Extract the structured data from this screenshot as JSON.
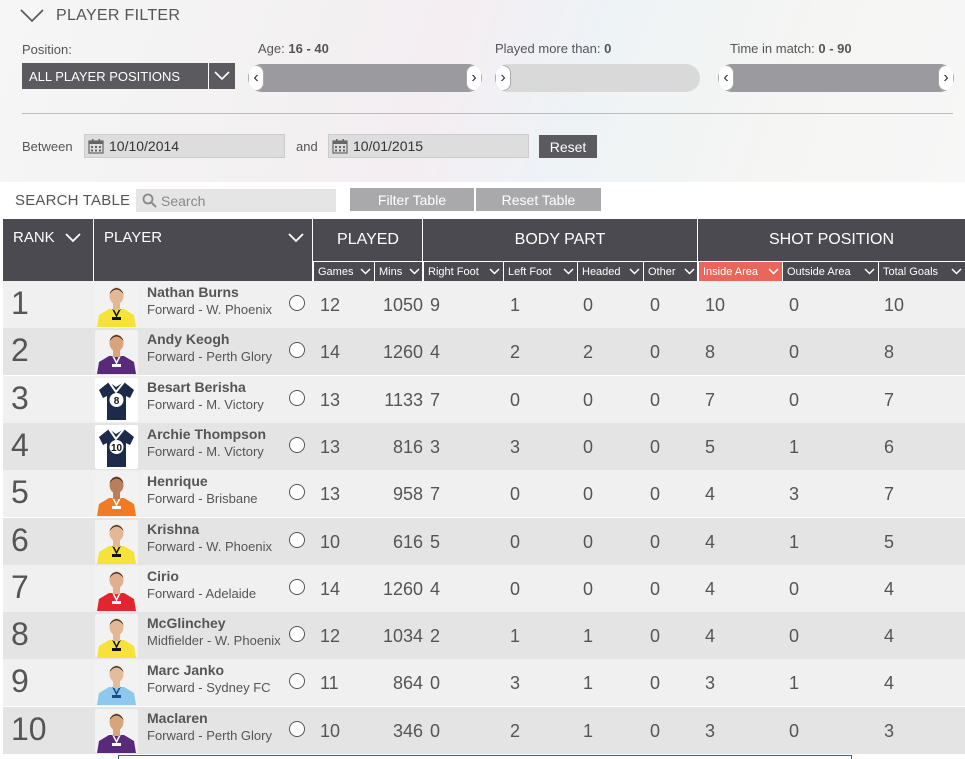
{
  "filter": {
    "title": "PLAYER FILTER",
    "position_label": "Position:",
    "position_value": "ALL PLAYER POSITIONS",
    "age_label": "Age:",
    "age_value": "16 - 40",
    "played_label": "Played more than:",
    "played_value": "0",
    "time_label": "Time in match:",
    "time_value": "0 - 90",
    "between_label": "Between",
    "and_label": "and",
    "date_from": "10/10/2014",
    "date_to": "10/01/2015",
    "reset_label": "Reset"
  },
  "search": {
    "label": "SEARCH TABLE",
    "placeholder": "Search",
    "filter_button": "Filter Table",
    "reset_button": "Reset Table"
  },
  "table": {
    "headers": {
      "rank": "RANK",
      "player": "PLAYER",
      "played": "PLAYED",
      "body_part": "BODY PART",
      "shot_position": "SHOT POSITION"
    },
    "subheaders": [
      "Games",
      "Mins",
      "Right Foot",
      "Left Foot",
      "Headed",
      "Other",
      "Inside Area",
      "Outside Area",
      "Total Goals"
    ],
    "active_subheader_color": "#e8675a",
    "rows": [
      {
        "rank": "1",
        "name": "Nathan Burns",
        "team": "Forward - W. Phoenix",
        "games": "12",
        "mins": "1050",
        "right": "9",
        "left": "1",
        "headed": "0",
        "other": "0",
        "inside": "10",
        "outside": "0",
        "total": "10"
      },
      {
        "rank": "2",
        "name": "Andy Keogh",
        "team": "Forward - Perth Glory",
        "games": "14",
        "mins": "1260",
        "right": "4",
        "left": "2",
        "headed": "2",
        "other": "0",
        "inside": "8",
        "outside": "0",
        "total": "8"
      },
      {
        "rank": "3",
        "name": "Besart Berisha",
        "team": "Forward - M. Victory",
        "games": "13",
        "mins": "1133",
        "right": "7",
        "left": "0",
        "headed": "0",
        "other": "0",
        "inside": "7",
        "outside": "0",
        "total": "7"
      },
      {
        "rank": "4",
        "name": "Archie Thompson",
        "team": "Forward - M. Victory",
        "games": "13",
        "mins": "816",
        "right": "3",
        "left": "3",
        "headed": "0",
        "other": "0",
        "inside": "5",
        "outside": "1",
        "total": "6"
      },
      {
        "rank": "5",
        "name": "Henrique",
        "team": "Forward - Brisbane",
        "games": "13",
        "mins": "958",
        "right": "7",
        "left": "0",
        "headed": "0",
        "other": "0",
        "inside": "4",
        "outside": "3",
        "total": "7"
      },
      {
        "rank": "6",
        "name": "Krishna",
        "team": "Forward - W. Phoenix",
        "games": "10",
        "mins": "616",
        "right": "5",
        "left": "0",
        "headed": "0",
        "other": "0",
        "inside": "4",
        "outside": "1",
        "total": "5"
      },
      {
        "rank": "7",
        "name": "Cirio",
        "team": "Forward - Adelaide",
        "games": "14",
        "mins": "1260",
        "right": "4",
        "left": "0",
        "headed": "0",
        "other": "0",
        "inside": "4",
        "outside": "0",
        "total": "4"
      },
      {
        "rank": "8",
        "name": "McGlinchey",
        "team": "Midfielder - W. Phoenix",
        "games": "12",
        "mins": "1034",
        "right": "2",
        "left": "1",
        "headed": "1",
        "other": "0",
        "inside": "4",
        "outside": "0",
        "total": "4"
      },
      {
        "rank": "9",
        "name": "Marc Janko",
        "team": "Forward - Sydney FC",
        "games": "11",
        "mins": "864",
        "right": "0",
        "left": "3",
        "headed": "1",
        "other": "0",
        "inside": "3",
        "outside": "1",
        "total": "4"
      },
      {
        "rank": "10",
        "name": "Maclaren",
        "team": "Forward - Perth Glory",
        "games": "10",
        "mins": "346",
        "right": "0",
        "left": "2",
        "headed": "1",
        "other": "0",
        "inside": "3",
        "outside": "0",
        "total": "3"
      }
    ],
    "jersey_styles": [
      "phoenix",
      "perth",
      "victory8",
      "victory10",
      "brisbane",
      "phoenix",
      "adelaide",
      "phoenix",
      "sydney",
      "perth"
    ],
    "jersey_numbers": [
      "",
      "",
      "8",
      "10",
      "",
      "",
      "",
      "",
      "",
      ""
    ]
  },
  "colors": {
    "header_bg": "#4a4a50",
    "button_dark": "#5a5a5f",
    "button_light": "#a9a9ab",
    "active": "#e8675a"
  }
}
